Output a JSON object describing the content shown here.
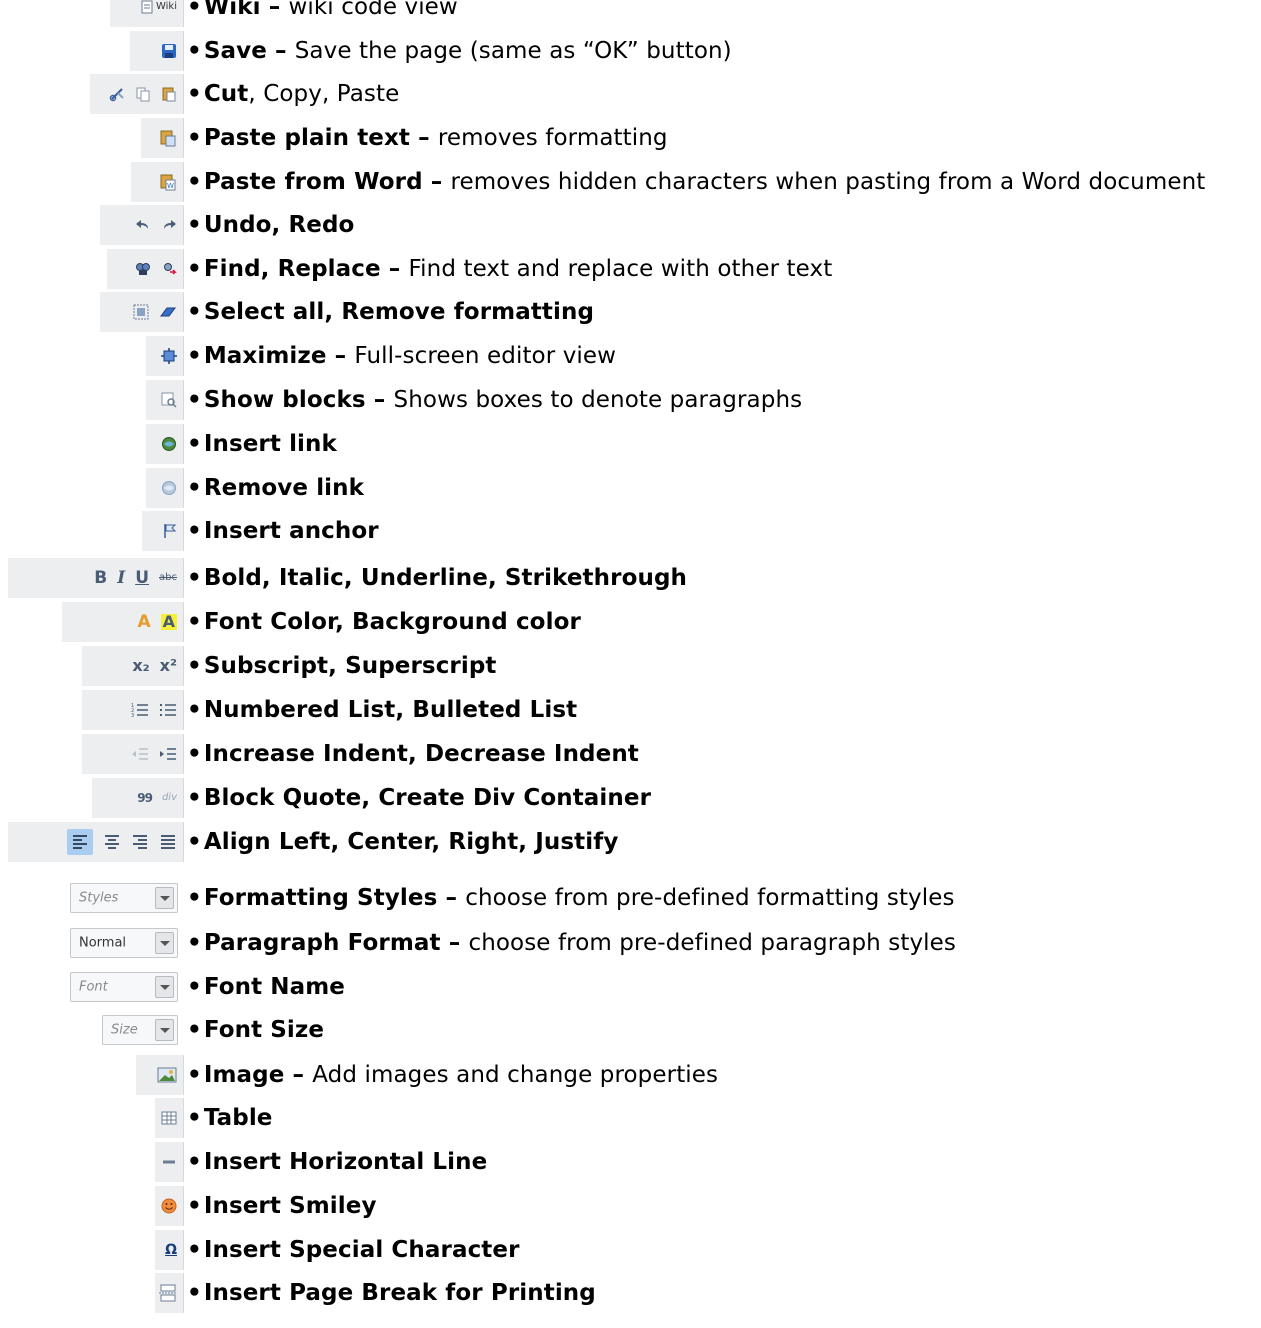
{
  "items": [
    {
      "title": "Wiki",
      "sep": " – ",
      "desc": "wiki code view",
      "icons": [
        "wiki-icon"
      ],
      "label": "Wiki"
    },
    {
      "title": "Save",
      "sep": " – ",
      "desc": "Save the page (same as “OK” button)",
      "icons": [
        "save-icon"
      ]
    },
    {
      "title": "Cut",
      "sep": ", ",
      "desc": "Copy, Paste",
      "icons": [
        "cut-icon",
        "copy-icon",
        "paste-icon"
      ]
    },
    {
      "title": "Paste plain text",
      "sep": " – ",
      "desc": "removes formatting",
      "icons": [
        "paste-text-icon"
      ]
    },
    {
      "title": "Paste from Word",
      "sep": " – ",
      "desc": "removes hidden characters when pasting from a Word document",
      "icons": [
        "paste-word-icon"
      ]
    },
    {
      "title": "Undo, Redo",
      "sep": "",
      "desc": "",
      "icons": [
        "undo-icon",
        "redo-icon"
      ]
    },
    {
      "title": "Find, Replace",
      "sep": " – ",
      "desc": "Find text and replace with other text",
      "icons": [
        "find-icon",
        "replace-icon"
      ]
    },
    {
      "title": "Select all, Remove formatting",
      "sep": "",
      "desc": "",
      "icons": [
        "select-all-icon",
        "remove-format-icon"
      ]
    },
    {
      "title": "Maximize",
      "sep": " – ",
      "desc": "Full-screen editor view",
      "icons": [
        "maximize-icon"
      ]
    },
    {
      "title": "Show blocks",
      "sep": " – ",
      "desc": "Shows boxes to denote paragraphs",
      "icons": [
        "show-blocks-icon"
      ]
    },
    {
      "title": "Insert link",
      "sep": "",
      "desc": "",
      "icons": [
        "link-icon"
      ]
    },
    {
      "title": "Remove link",
      "sep": "",
      "desc": "",
      "icons": [
        "unlink-icon"
      ]
    },
    {
      "title": "Insert anchor",
      "sep": "",
      "desc": "",
      "icons": [
        "anchor-icon"
      ]
    },
    {
      "title": "Bold, Italic, Underline, Strikethrough",
      "sep": "",
      "desc": "",
      "icons": [
        "bold-icon",
        "italic-icon",
        "underline-icon",
        "strike-icon"
      ],
      "glyphs": [
        "B",
        "I",
        "U",
        "abc"
      ]
    },
    {
      "title": "Font Color, Background color",
      "sep": "",
      "desc": "",
      "icons": [
        "font-color-icon",
        "bg-color-icon"
      ],
      "glyphs": [
        "A",
        "A"
      ]
    },
    {
      "title": "Subscript, Superscript",
      "sep": "",
      "desc": "",
      "icons": [
        "subscript-icon",
        "superscript-icon"
      ],
      "glyphs": [
        "x₂",
        "x²"
      ]
    },
    {
      "title": "Numbered List, Bulleted List",
      "sep": "",
      "desc": "",
      "icons": [
        "numbered-list-icon",
        "bulleted-list-icon"
      ]
    },
    {
      "title": "Increase Indent, Decrease Indent",
      "sep": "",
      "desc": "",
      "icons": [
        "outdent-icon",
        "indent-icon"
      ]
    },
    {
      "title": "Block Quote, Create Div Container",
      "sep": "",
      "desc": "",
      "icons": [
        "blockquote-icon",
        "div-icon"
      ],
      "glyphs": [
        "99",
        "div"
      ]
    },
    {
      "title": "Align Left, Center, Right, Justify",
      "sep": "",
      "desc": "",
      "icons": [
        "align-left-icon",
        "align-center-icon",
        "align-right-icon",
        "align-justify-icon"
      ]
    },
    {
      "title": "Formatting Styles",
      "sep": " – ",
      "desc": "choose from pre-defined formatting styles",
      "select": "Styles"
    },
    {
      "title": "Paragraph Format",
      "sep": " – ",
      "desc": "choose from pre-defined paragraph styles",
      "select": "Normal"
    },
    {
      "title": "Font Name",
      "sep": "",
      "desc": "",
      "select": "Font"
    },
    {
      "title": "Font Size",
      "sep": "",
      "desc": "",
      "select": "Size"
    },
    {
      "title": "Image",
      "sep": " – ",
      "desc": "Add images and change properties",
      "icons": [
        "image-icon"
      ]
    },
    {
      "title": "Table",
      "sep": "",
      "desc": "",
      "icons": [
        "table-icon"
      ]
    },
    {
      "title": "Insert Horizontal Line",
      "sep": "",
      "desc": "",
      "icons": [
        "horizontal-line-icon"
      ]
    },
    {
      "title": "Insert Smiley",
      "sep": "",
      "desc": "",
      "icons": [
        "smiley-icon"
      ]
    },
    {
      "title": "Insert Special Character",
      "sep": "",
      "desc": "",
      "icons": [
        "special-char-icon"
      ],
      "glyphs": [
        "Ω"
      ]
    },
    {
      "title": "Insert Page Break for Printing",
      "sep": "",
      "desc": "",
      "icons": [
        "page-break-icon"
      ]
    }
  ],
  "bullet": "•"
}
